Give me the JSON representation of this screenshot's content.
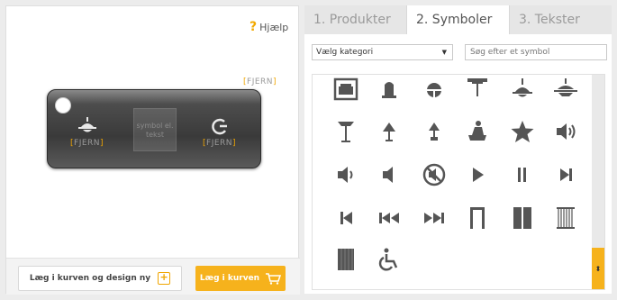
{
  "help": {
    "label": "Hjælp",
    "mark": "?"
  },
  "tag": {
    "remove_top": "FJERN",
    "slot_left_remove": "FJERN",
    "slot_middle_text": "symbol el. tekst",
    "slot_right_remove": "FJERN"
  },
  "buttons": {
    "add_and_new": "Læg i kurven og design ny",
    "add_to_cart": "Læg i kurven"
  },
  "tabs": [
    {
      "label": "1. Produkter",
      "active": false
    },
    {
      "label": "2. Symboler",
      "active": true
    },
    {
      "label": "3. Tekster",
      "active": false
    }
  ],
  "category": {
    "selected": "Vælg kategori"
  },
  "search": {
    "placeholder": "Søg efter et symbol"
  },
  "symbols": [
    "garage-icon",
    "ceiling-light-icon",
    "half-circle-lamp-icon",
    "ceiling-fan-icon",
    "pendant-lamp-icon",
    "wide-pendant-lamp-icon",
    "floor-lamp-icon",
    "table-lamp-icon",
    "small-table-lamp-icon",
    "reading-person-icon",
    "star-icon",
    "speaker-loud-icon",
    "speaker-medium-icon",
    "speaker-low-icon",
    "mute-icon",
    "play-icon",
    "pause-icon",
    "next-track-icon",
    "previous-track-icon",
    "rewind-icon",
    "fast-forward-icon",
    "door-frame-icon",
    "double-door-icon",
    "curtain-icon",
    "blind-icon",
    "wheelchair-icon"
  ],
  "colors": {
    "accent": "#f6b21c",
    "icon": "#555555"
  }
}
